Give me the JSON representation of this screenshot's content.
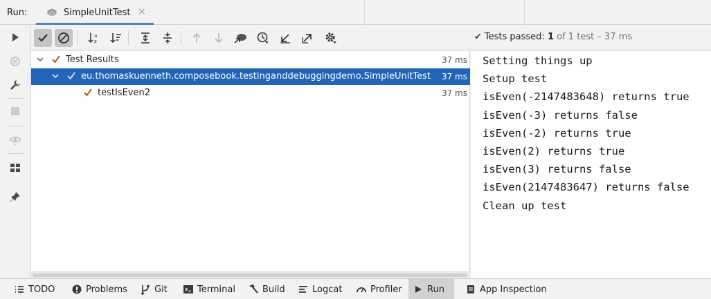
{
  "header": {
    "run_label": "Run:",
    "tab_title": "SimpleUnitTest",
    "tab_close": "×"
  },
  "toolbar": {
    "status_prefix": "Tests passed:",
    "status_passed": "1",
    "status_suffix": "of 1 test – 37 ms"
  },
  "tree": {
    "rows": [
      {
        "label": "Test Results",
        "time": "37 ms"
      },
      {
        "label": "eu.thomaskuenneth.composebook.testinganddebuggingdemo.SimpleUnitTest",
        "time": "37 ms"
      },
      {
        "label": "testIsEven2",
        "time": "37 ms"
      }
    ]
  },
  "console": {
    "lines": [
      "Setting things up",
      "Setup test",
      "isEven(-2147483648) returns true",
      "isEven(-3) returns false",
      "isEven(-2) returns true",
      "isEven(2) returns true",
      "isEven(3) returns false",
      "isEven(2147483647) returns false",
      "Clean up test"
    ]
  },
  "bottom_bar": {
    "items": [
      {
        "label": "TODO",
        "icon": "list-icon"
      },
      {
        "label": "Problems",
        "icon": "problems-icon"
      },
      {
        "label": "Git",
        "icon": "git-branch-icon"
      },
      {
        "label": "Terminal",
        "icon": "terminal-icon"
      },
      {
        "label": "Build",
        "icon": "hammer-icon"
      },
      {
        "label": "Logcat",
        "icon": "logcat-icon"
      },
      {
        "label": "Profiler",
        "icon": "gauge-icon"
      },
      {
        "label": "Run",
        "icon": "play-icon"
      },
      {
        "label": "App Inspection",
        "icon": "inspection-icon"
      }
    ]
  },
  "colors": {
    "selection": "#2264b8",
    "pass_tick": "#b05c1c",
    "tab_underline": "#4a86c8"
  }
}
